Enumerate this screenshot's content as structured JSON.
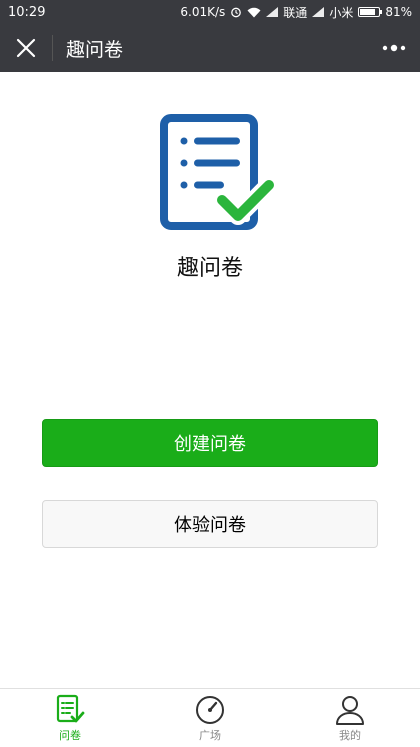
{
  "status_bar": {
    "time": "10:29",
    "speed": "6.01K/s",
    "carrier1": "联通",
    "carrier2": "小米",
    "battery": "81%"
  },
  "title_bar": {
    "title": "趣问卷",
    "close_icon": "close-icon",
    "more_icon": "more-icon"
  },
  "main": {
    "app_name": "趣问卷",
    "logo_icon": "questionnaire-check-icon",
    "create_button": "创建问卷",
    "experience_button": "体验问卷"
  },
  "tab_bar": {
    "tabs": [
      {
        "label": "问卷",
        "icon": "questionnaire-icon",
        "active": true
      },
      {
        "label": "广场",
        "icon": "compass-icon",
        "active": false
      },
      {
        "label": "我的",
        "icon": "person-icon",
        "active": false
      }
    ]
  },
  "colors": {
    "bar_bg": "#393a3f",
    "primary_green": "#1aad19",
    "logo_blue": "#1e5fa8"
  }
}
